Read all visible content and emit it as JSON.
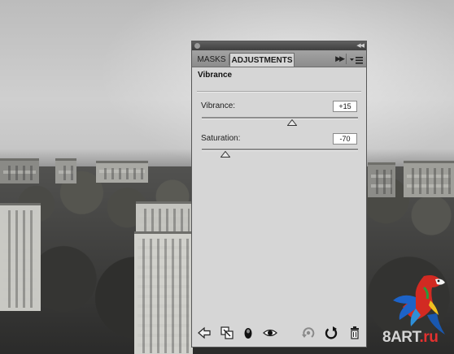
{
  "panel": {
    "tabs": [
      {
        "label": "MASKS",
        "active": false
      },
      {
        "label": "ADJUSTMENTS",
        "active": true
      }
    ],
    "section_title": "Vibrance",
    "controls": [
      {
        "label": "Vibrance:",
        "value": "+15",
        "slider_fraction": 0.58
      },
      {
        "label": "Saturation:",
        "value": "-70",
        "slider_fraction": 0.15
      }
    ],
    "bottom_icons": [
      "back-arrow-icon",
      "clip-to-layer-icon",
      "layer-mask-icon",
      "visibility-eye-icon",
      "view-previous-state-icon",
      "reset-icon",
      "trash-icon"
    ]
  },
  "watermark": {
    "text_main": "8ART",
    "text_suffix": ".ru"
  },
  "colors": {
    "panel_bg": "#d6d6d6",
    "watermark_accent": "#e4312f"
  }
}
